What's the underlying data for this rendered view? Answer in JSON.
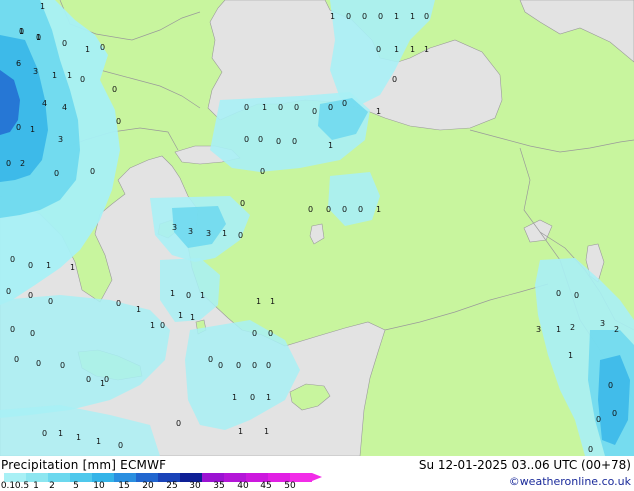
{
  "footer": {
    "title": "Precipitation [mm]  ECMWF",
    "date": "Su 12-01-2025 03..06 UTC (00+78)",
    "credit": "©weatheronline.co.uk"
  },
  "colorbar": {
    "labels": [
      "0.1",
      "0.5",
      "1",
      "2",
      "5",
      "10",
      "15",
      "20",
      "25",
      "30",
      "35",
      "40",
      "45",
      "50"
    ],
    "colors": [
      "#a8f0f5",
      "#8de6f0",
      "#6cd8ee",
      "#4fc8ec",
      "#34b4e8",
      "#2a8fe0",
      "#2166cf",
      "#1a43b8",
      "#0e1f95",
      "#9b13d2",
      "#b416d8",
      "#cc18de",
      "#e11fe4",
      "#f22ce8"
    ]
  },
  "colors": {
    "land": "#c8f59e",
    "sea": "#e3e3e3",
    "precip_light": "#a8f0f5",
    "precip_mid": "#6cd8ee",
    "precip_heavy": "#2a8fe0"
  },
  "map_labels": [
    "1",
    "1",
    "0",
    "1",
    "0",
    "1",
    "6",
    "3",
    "1",
    "1",
    "0",
    "4",
    "4",
    "0",
    "1",
    "3",
    "2",
    "0",
    "0",
    "0",
    "0",
    "0",
    "0",
    "1",
    "0",
    "0",
    "0",
    "0",
    "0",
    "1",
    "1",
    "0",
    "0",
    "0",
    "1",
    "1",
    "0",
    "0",
    "1",
    "1",
    "1",
    "0",
    "3",
    "3",
    "3",
    "1",
    "0",
    "0",
    "0",
    "0",
    "0",
    "1",
    "0",
    "0",
    "0",
    "0",
    "0",
    "0",
    "1",
    "1",
    "1",
    "0",
    "0",
    "0",
    "0",
    "0",
    "0",
    "0",
    "1",
    "0",
    "1",
    "1",
    "1",
    "1",
    "0",
    "1",
    "1",
    "1",
    "1",
    "0",
    "0",
    "0",
    "1",
    "1",
    "0",
    "0",
    "0",
    "0",
    "0",
    "0",
    "0",
    "0",
    "0",
    "0",
    "1",
    "1",
    "1",
    "0",
    "0",
    "3",
    "1",
    "2",
    "0",
    "0",
    "1",
    "3",
    "2",
    "0",
    "0",
    "0",
    "0",
    "0",
    "1",
    "1",
    "0",
    "0",
    "0"
  ]
}
